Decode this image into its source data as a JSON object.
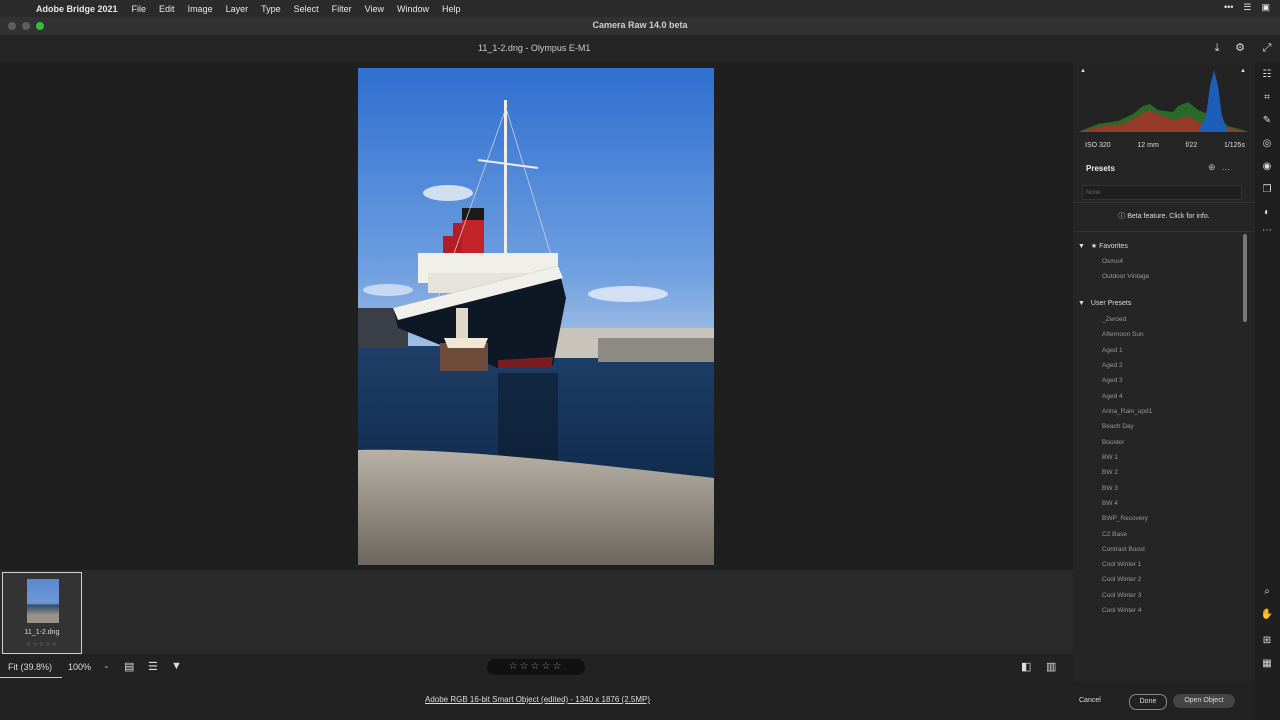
{
  "menubar": {
    "app": "Adobe Bridge 2021",
    "items": [
      "File",
      "Edit",
      "Image",
      "Layer",
      "Type",
      "Select",
      "Filter",
      "View",
      "Window",
      "Help"
    ]
  },
  "window": {
    "title": "Camera Raw 14.0 beta"
  },
  "header": {
    "filename": "11_1-2.dng  -  Olympus E-M1"
  },
  "filmstrip": {
    "thumb_name": "11_1-2.dng",
    "thumb_rating": "☆☆☆☆☆"
  },
  "bottombar": {
    "zoom_fit": "Fit (39.8%)",
    "zoom_100": "100%",
    "stars": "☆☆☆☆☆",
    "info": "Adobe RGB 16-bit Smart Object (edited) - 1340 x 1876 (2.5MP)"
  },
  "exif": {
    "iso": "ISO 320",
    "focal": "12 mm",
    "aperture": "f/22",
    "shutter": "1/125s"
  },
  "presets": {
    "title": "Presets",
    "search_placeholder": "None",
    "beta_note": "Beta feature. Click for info.",
    "favorites_label": "Favorites",
    "favorites": [
      "Osmo4",
      "Outdoor Vintage"
    ],
    "user_label": "User Presets",
    "user": [
      "_Zeroed",
      "Afternoon Sun",
      "Aged 1",
      "Aged 2",
      "Aged 3",
      "Aged 4",
      "Arina_Rain_upd1",
      "Beach Day",
      "Booster",
      "BW 1",
      "BW 2",
      "BW 3",
      "BW 4",
      "BWP_Recovery",
      "C2 Base",
      "Contrast Boost",
      "Cool Winter 1",
      "Cool Winter 2",
      "Cool Winter 3",
      "Cool Winter 4"
    ]
  },
  "footer": {
    "cancel": "Cancel",
    "done": "Done",
    "open": "Open Object"
  },
  "colors": {
    "accent": "#0f7cf0",
    "panel": "#252525",
    "canvas": "#1e1f1e"
  }
}
